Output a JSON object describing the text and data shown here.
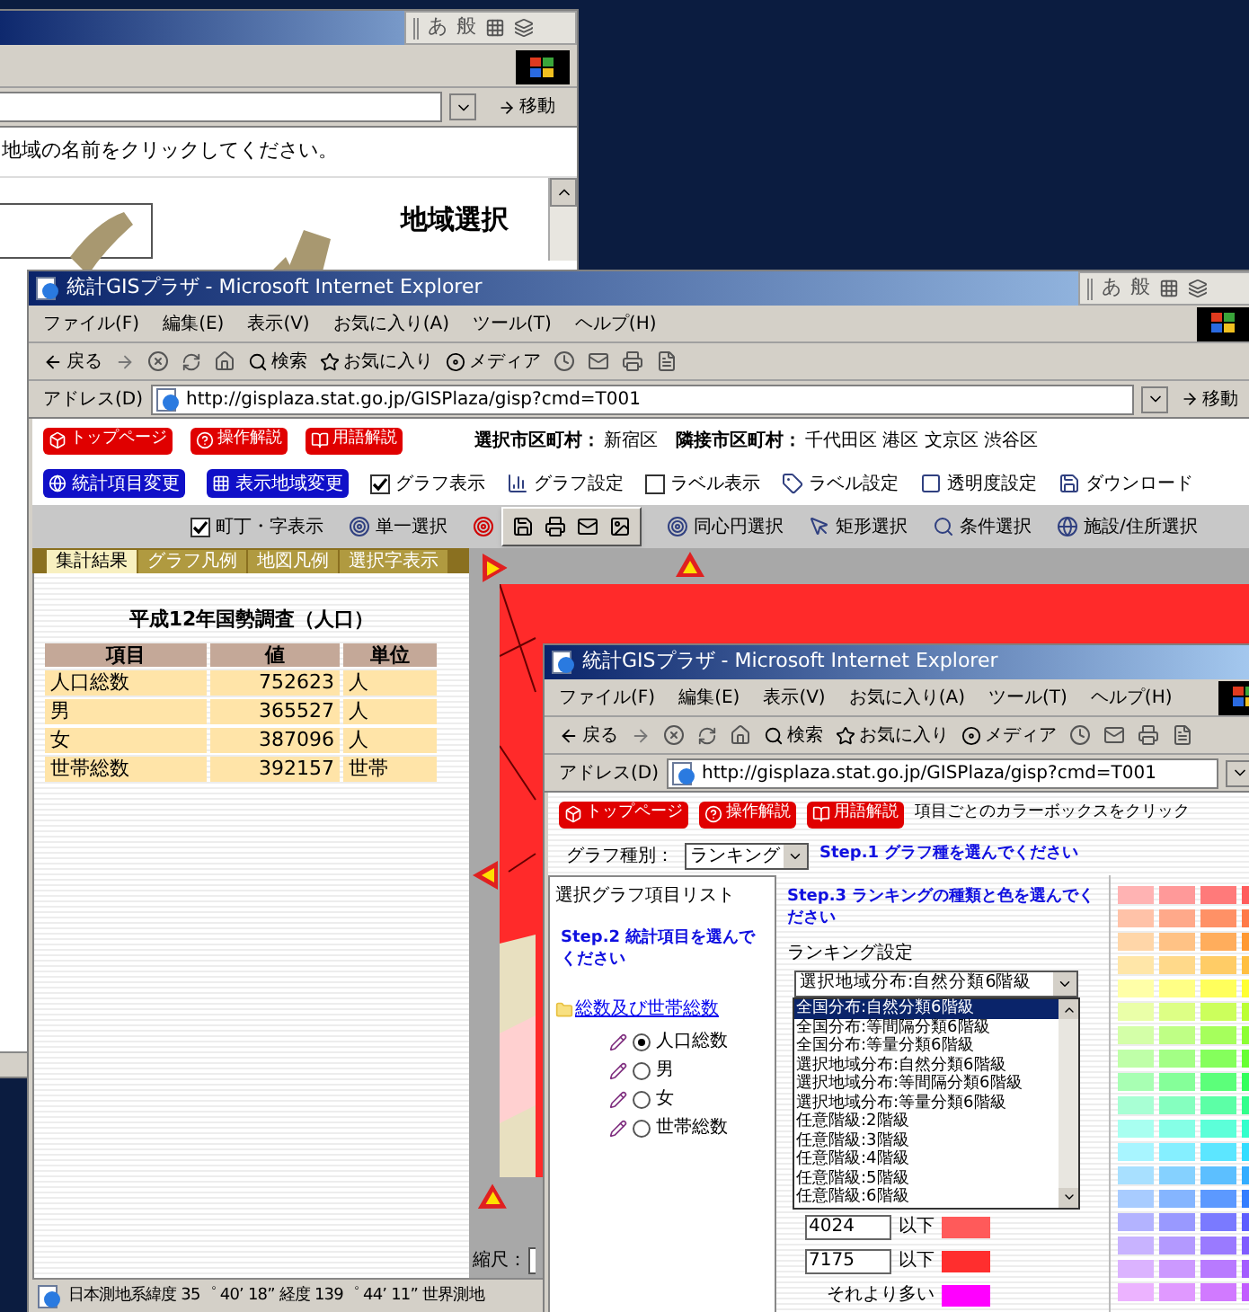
{
  "back_window": {
    "language_bar": [
      "あ",
      "般"
    ],
    "go_button": "移動",
    "instruction": "地域の名前をクリックしてください。",
    "heading": "地域選択"
  },
  "main_window": {
    "title": "統計GISプラザ - Microsoft Internet Explorer",
    "language_bar": [
      "あ",
      "般"
    ],
    "menu": [
      "ファイル(F)",
      "編集(E)",
      "表示(V)",
      "お気に入り(A)",
      "ツール(T)",
      "ヘルプ(H)"
    ],
    "toolbar": [
      "戻る",
      "検索",
      "お気に入り",
      "メディア"
    ],
    "address_label": "アドレス(D)",
    "url": "http://gisplaza.stat.go.jp/GISPlaza/gisp?cmd=T001",
    "go_button": "移動",
    "nav_buttons": [
      "トップページ",
      "操作解説",
      "用語解説"
    ],
    "selected_city_label": "選択市区町村：",
    "selected_city": "新宿区",
    "adjacent_label": "隣接市区町村：",
    "adjacent_cities": "千代田区 港区 文京区 渋谷区",
    "controls": [
      {
        "kind": "blue_button",
        "label": "統計項目変更"
      },
      {
        "kind": "blue_button",
        "label": "表示地域変更"
      },
      {
        "kind": "checkbox",
        "label": "グラフ表示",
        "checked": true
      },
      {
        "kind": "tool",
        "label": "グラフ設定"
      },
      {
        "kind": "checkbox",
        "label": "ラベル表示",
        "checked": false
      },
      {
        "kind": "tool",
        "label": "ラベル設定"
      },
      {
        "kind": "tool",
        "label": "透明度設定"
      },
      {
        "kind": "tool",
        "label": "ダウンロード"
      }
    ],
    "selection_tools": [
      {
        "kind": "checkbox",
        "label": "町丁・字表示",
        "checked": true
      },
      {
        "kind": "tool",
        "label": "単一選択"
      },
      {
        "kind": "floating_toolbar"
      },
      {
        "kind": "tool",
        "label": "同心円選択"
      },
      {
        "kind": "tool",
        "label": "矩形選択"
      },
      {
        "kind": "tool",
        "label": "条件選択"
      },
      {
        "kind": "tool",
        "label": "施設/住所選択"
      }
    ],
    "tabs": [
      {
        "label": "集計結果",
        "selected": true
      },
      {
        "label": "グラフ凡例",
        "selected": false
      },
      {
        "label": "地図凡例",
        "selected": false
      },
      {
        "label": "選択字表示",
        "selected": false
      }
    ],
    "table": {
      "title": "平成12年国勢調査（人口）",
      "columns": [
        "項目",
        "値",
        "単位"
      ],
      "rows": [
        [
          "人口総数",
          "752623",
          "人"
        ],
        [
          "男",
          "365527",
          "人"
        ],
        [
          "女",
          "387096",
          "人"
        ],
        [
          "世帯総数",
          "392157",
          "世帯"
        ]
      ]
    },
    "scale_label": "縮尺：",
    "status_bar": "日本測地系緯度 35゜ 40’ 18” 経度 139゜ 44’ 11” 世界測地"
  },
  "popup_window": {
    "title": "統計GISプラザ - Microsoft Internet Explorer",
    "menu": [
      "ファイル(F)",
      "編集(E)",
      "表示(V)",
      "お気に入り(A)",
      "ツール(T)",
      "ヘルプ(H)"
    ],
    "toolbar": [
      "戻る",
      "検索",
      "お気に入り",
      "メディア"
    ],
    "address_label": "アドレス(D)",
    "url": "http://gisplaza.stat.go.jp/GISPlaza/gisp?cmd=T001",
    "nav_buttons": [
      "トップページ",
      "操作解説",
      "用語解説"
    ],
    "instruction": "項目ごとのカラーボックスをクリック",
    "graph_type_label": "グラフ種別：",
    "graph_type_value": "ランキング",
    "step1": "Step.1 グラフ種を選んでください",
    "list_title": "選択グラフ項目リスト",
    "step2": "Step.2 統計項目を選んでください",
    "folder": "総数及び世帯総数",
    "items": [
      {
        "label": "人口総数",
        "selected": true
      },
      {
        "label": "男",
        "selected": false
      },
      {
        "label": "女",
        "selected": false
      },
      {
        "label": "世帯総数",
        "selected": false
      }
    ],
    "step3": "Step.3 ランキングの種類と色を選んでください",
    "ranking_label": "ランキング設定",
    "ranking_value": "選択地域分布:自然分類6階級",
    "ranking_options": [
      {
        "label": "全国分布:自然分類6階級",
        "selected": true
      },
      {
        "label": "全国分布:等間隔分類6階級",
        "selected": false
      },
      {
        "label": "全国分布:等量分類6階級",
        "selected": false
      },
      {
        "label": "選択地域分布:自然分類6階級",
        "selected": false
      },
      {
        "label": "選択地域分布:等間隔分類6階級",
        "selected": false
      },
      {
        "label": "選択地域分布:等量分類6階級",
        "selected": false
      },
      {
        "label": "任意階級:2階級",
        "selected": false
      },
      {
        "label": "任意階級:3階級",
        "selected": false
      },
      {
        "label": "任意階級:4階級",
        "selected": false
      },
      {
        "label": "任意階級:5階級",
        "selected": false
      },
      {
        "label": "任意階級:6階級",
        "selected": false
      }
    ],
    "thresholds": [
      {
        "kind": "input",
        "value": "4024",
        "suffix": "以下",
        "color": "#ff5a5a"
      },
      {
        "kind": "input",
        "value": "7175",
        "suffix": "以下",
        "color": "#ff2e2e"
      },
      {
        "kind": "text",
        "label": "それより多い",
        "color": "#ff00ff"
      }
    ],
    "palette": [
      {
        "swatches": [
          {
            "color": "#ffb3b3"
          },
          {
            "color": "#ff9999"
          },
          {
            "color": "#ff7a7a"
          },
          {
            "color": "#ff5c5c"
          }
        ]
      },
      {
        "swatches": [
          {
            "color": "#ffc2a8"
          },
          {
            "color": "#ffa98a"
          },
          {
            "color": "#ff9166"
          },
          {
            "color": "#ff7a47"
          }
        ]
      },
      {
        "swatches": [
          {
            "color": "#ffd6a8"
          },
          {
            "color": "#ffc285"
          },
          {
            "color": "#ffad5c"
          },
          {
            "color": "#ff9933"
          }
        ]
      },
      {
        "swatches": [
          {
            "color": "#ffe6a8"
          },
          {
            "color": "#ffd98a"
          },
          {
            "color": "#ffcc66"
          },
          {
            "color": "#ffbf40"
          }
        ]
      },
      {
        "swatches": [
          {
            "color": "#ffffa8"
          },
          {
            "color": "#ffff85"
          },
          {
            "color": "#ffff5c"
          },
          {
            "color": "#ffff33"
          }
        ]
      },
      {
        "swatches": [
          {
            "color": "#eaffa8"
          },
          {
            "color": "#ddff85"
          },
          {
            "color": "#ccff5c"
          },
          {
            "color": "#bbff33"
          }
        ]
      },
      {
        "swatches": [
          {
            "color": "#d4ffa8"
          },
          {
            "color": "#bfff85"
          },
          {
            "color": "#a6ff5c"
          },
          {
            "color": "#8cff33"
          }
        ]
      },
      {
        "swatches": [
          {
            "color": "#bfffa8"
          },
          {
            "color": "#a3ff85"
          },
          {
            "color": "#85ff5c"
          },
          {
            "color": "#66ff33"
          }
        ]
      },
      {
        "swatches": [
          {
            "color": "#a8ffb3"
          },
          {
            "color": "#85ff99"
          },
          {
            "color": "#5cff7a"
          },
          {
            "color": "#33ff5c"
          }
        ]
      },
      {
        "swatches": [
          {
            "color": "#a8ffd4"
          },
          {
            "color": "#85ffbf"
          },
          {
            "color": "#5cffa6"
          },
          {
            "color": "#33ff8c"
          }
        ]
      },
      {
        "swatches": [
          {
            "color": "#a8fff0"
          },
          {
            "color": "#85ffe6"
          },
          {
            "color": "#5cffd9"
          },
          {
            "color": "#33ffcc"
          }
        ]
      },
      {
        "swatches": [
          {
            "color": "#a8f5ff"
          },
          {
            "color": "#85efff"
          },
          {
            "color": "#5ce6ff"
          },
          {
            "color": "#33ddff"
          }
        ]
      },
      {
        "swatches": [
          {
            "color": "#a8e0ff"
          },
          {
            "color": "#85d1ff"
          },
          {
            "color": "#5cbfff"
          },
          {
            "color": "#33adff"
          }
        ]
      },
      {
        "swatches": [
          {
            "color": "#a8ccff"
          },
          {
            "color": "#85b5ff"
          },
          {
            "color": "#5c99ff"
          },
          {
            "color": "#337dff"
          }
        ]
      },
      {
        "swatches": [
          {
            "color": "#b3b3ff"
          },
          {
            "color": "#9999ff"
          },
          {
            "color": "#7a7aff"
          },
          {
            "color": "#5c5cff"
          }
        ]
      },
      {
        "swatches": [
          {
            "color": "#c8b3ff"
          },
          {
            "color": "#b399ff"
          },
          {
            "color": "#9a7aff"
          },
          {
            "color": "#805cff"
          }
        ]
      },
      {
        "swatches": [
          {
            "color": "#dbb3ff"
          },
          {
            "color": "#cc99ff"
          },
          {
            "color": "#b87aff"
          },
          {
            "color": "#a35cff"
          }
        ]
      },
      {
        "swatches": [
          {
            "color": "#ecb3ff"
          },
          {
            "color": "#e099ff"
          },
          {
            "color": "#d17aff"
          },
          {
            "color": "#c25cff"
          }
        ]
      }
    ]
  }
}
